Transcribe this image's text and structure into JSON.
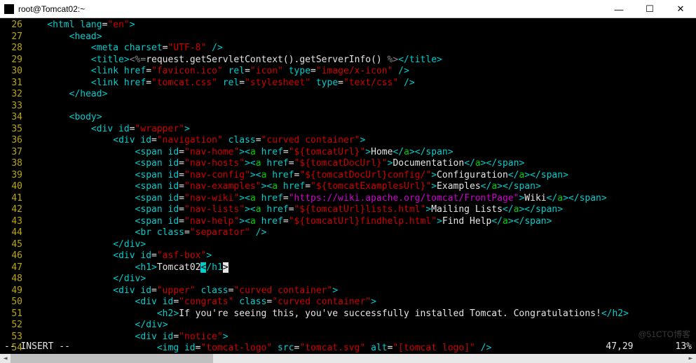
{
  "title": "root@Tomcat02:~",
  "lines": {
    "l26": {
      "n": "26",
      "i": 1,
      "seg": [
        [
          "<",
          "c-cyan"
        ],
        [
          "html",
          "c-cyan"
        ],
        [
          " lang",
          "c-cyan"
        ],
        [
          "=",
          "c-wht"
        ],
        [
          "\"en\"",
          "c-red"
        ],
        [
          ">",
          "c-cyan"
        ]
      ]
    },
    "l27": {
      "n": "27",
      "i": 2,
      "seg": [
        [
          "<",
          "c-cyan"
        ],
        [
          "head",
          "c-cyan"
        ],
        [
          ">",
          "c-cyan"
        ]
      ]
    },
    "l28": {
      "n": "28",
      "i": 3,
      "seg": [
        [
          "<",
          "c-cyan"
        ],
        [
          "meta",
          "c-cyan"
        ],
        [
          " charset",
          "c-cyan"
        ],
        [
          "=",
          "c-wht"
        ],
        [
          "\"UTF-8\"",
          "c-red"
        ],
        [
          " />",
          "c-cyan"
        ]
      ]
    },
    "l29": {
      "n": "29",
      "i": 3,
      "seg": [
        [
          "<",
          "c-cyan"
        ],
        [
          "title",
          "c-cyan"
        ],
        [
          ">",
          "c-cyan"
        ],
        [
          "<%=",
          "c-gry"
        ],
        [
          "request.getServletContext().getServerInfo()",
          "c-wht"
        ],
        [
          " %>",
          "c-gry"
        ],
        [
          "</",
          "c-cyan"
        ],
        [
          "title",
          "c-cyan"
        ],
        [
          ">",
          "c-cyan"
        ]
      ]
    },
    "l30": {
      "n": "30",
      "i": 3,
      "seg": [
        [
          "<",
          "c-cyan"
        ],
        [
          "link",
          "c-cyan"
        ],
        [
          " href",
          "c-cyan"
        ],
        [
          "=",
          "c-wht"
        ],
        [
          "\"favicon.ico\"",
          "c-red"
        ],
        [
          " rel",
          "c-cyan"
        ],
        [
          "=",
          "c-wht"
        ],
        [
          "\"icon\"",
          "c-red"
        ],
        [
          " type",
          "c-cyan"
        ],
        [
          "=",
          "c-wht"
        ],
        [
          "\"image/x-icon\"",
          "c-red"
        ],
        [
          " />",
          "c-cyan"
        ]
      ]
    },
    "l31": {
      "n": "31",
      "i": 3,
      "seg": [
        [
          "<",
          "c-cyan"
        ],
        [
          "link",
          "c-cyan"
        ],
        [
          " href",
          "c-cyan"
        ],
        [
          "=",
          "c-wht"
        ],
        [
          "\"tomcat.css\"",
          "c-red"
        ],
        [
          " rel",
          "c-cyan"
        ],
        [
          "=",
          "c-wht"
        ],
        [
          "\"stylesheet\"",
          "c-red"
        ],
        [
          " type",
          "c-cyan"
        ],
        [
          "=",
          "c-wht"
        ],
        [
          "\"text/css\"",
          "c-red"
        ],
        [
          " />",
          "c-cyan"
        ]
      ]
    },
    "l32": {
      "n": "32",
      "i": 2,
      "seg": [
        [
          "</",
          "c-cyan"
        ],
        [
          "head",
          "c-cyan"
        ],
        [
          ">",
          "c-cyan"
        ]
      ]
    },
    "l33": {
      "n": "33",
      "i": 0,
      "seg": [
        [
          "",
          ""
        ]
      ]
    },
    "l34": {
      "n": "34",
      "i": 2,
      "seg": [
        [
          "<",
          "c-cyan"
        ],
        [
          "body",
          "c-cyan"
        ],
        [
          ">",
          "c-cyan"
        ]
      ]
    },
    "l35": {
      "n": "35",
      "i": 3,
      "seg": [
        [
          "<",
          "c-cyan"
        ],
        [
          "div",
          "c-cyan"
        ],
        [
          " id",
          "c-cyan"
        ],
        [
          "=",
          "c-wht"
        ],
        [
          "\"wrapper\"",
          "c-red"
        ],
        [
          ">",
          "c-cyan"
        ]
      ]
    },
    "l36": {
      "n": "36",
      "i": 4,
      "seg": [
        [
          "<",
          "c-cyan"
        ],
        [
          "div",
          "c-cyan"
        ],
        [
          " id",
          "c-cyan"
        ],
        [
          "=",
          "c-wht"
        ],
        [
          "\"navigation\"",
          "c-red"
        ],
        [
          " class",
          "c-cyan"
        ],
        [
          "=",
          "c-wht"
        ],
        [
          "\"curved container\"",
          "c-red"
        ],
        [
          ">",
          "c-cyan"
        ]
      ]
    },
    "l37": {
      "n": "37",
      "i": 5,
      "seg": [
        [
          "<",
          "c-cyan"
        ],
        [
          "span",
          "c-cyan"
        ],
        [
          " id",
          "c-cyan"
        ],
        [
          "=",
          "c-wht"
        ],
        [
          "\"nav-home\"",
          "c-red"
        ],
        [
          "><",
          "c-cyan"
        ],
        [
          "a",
          "c-grn"
        ],
        [
          " href",
          "c-cyan"
        ],
        [
          "=",
          "c-wht"
        ],
        [
          "\"${tomcatUrl}\"",
          "c-red"
        ],
        [
          ">",
          "c-cyan"
        ],
        [
          "Home",
          "c-wht"
        ],
        [
          "</",
          "c-cyan"
        ],
        [
          "a",
          "c-grn"
        ],
        [
          "></",
          "c-cyan"
        ],
        [
          "span",
          "c-cyan"
        ],
        [
          ">",
          "c-cyan"
        ]
      ]
    },
    "l38": {
      "n": "38",
      "i": 5,
      "seg": [
        [
          "<",
          "c-cyan"
        ],
        [
          "span",
          "c-cyan"
        ],
        [
          " id",
          "c-cyan"
        ],
        [
          "=",
          "c-wht"
        ],
        [
          "\"nav-hosts\"",
          "c-red"
        ],
        [
          "><",
          "c-cyan"
        ],
        [
          "a",
          "c-grn"
        ],
        [
          " href",
          "c-cyan"
        ],
        [
          "=",
          "c-wht"
        ],
        [
          "\"${tomcatDocUrl}\"",
          "c-red"
        ],
        [
          ">",
          "c-cyan"
        ],
        [
          "Documentation",
          "c-wht"
        ],
        [
          "</",
          "c-cyan"
        ],
        [
          "a",
          "c-grn"
        ],
        [
          "></",
          "c-cyan"
        ],
        [
          "span",
          "c-cyan"
        ],
        [
          ">",
          "c-cyan"
        ]
      ]
    },
    "l39": {
      "n": "39",
      "i": 5,
      "seg": [
        [
          "<",
          "c-cyan"
        ],
        [
          "span",
          "c-cyan"
        ],
        [
          " id",
          "c-cyan"
        ],
        [
          "=",
          "c-wht"
        ],
        [
          "\"nav-config\"",
          "c-red"
        ],
        [
          "><",
          "c-cyan"
        ],
        [
          "a",
          "c-grn"
        ],
        [
          " href",
          "c-cyan"
        ],
        [
          "=",
          "c-wht"
        ],
        [
          "\"${tomcatDocUrl}config/\"",
          "c-red"
        ],
        [
          ">",
          "c-cyan"
        ],
        [
          "Configuration",
          "c-wht"
        ],
        [
          "</",
          "c-cyan"
        ],
        [
          "a",
          "c-grn"
        ],
        [
          "></",
          "c-cyan"
        ],
        [
          "span",
          "c-cyan"
        ],
        [
          ">",
          "c-cyan"
        ]
      ]
    },
    "l40": {
      "n": "40",
      "i": 5,
      "seg": [
        [
          "<",
          "c-cyan"
        ],
        [
          "span",
          "c-cyan"
        ],
        [
          " id",
          "c-cyan"
        ],
        [
          "=",
          "c-wht"
        ],
        [
          "\"nav-examples\"",
          "c-red"
        ],
        [
          "><",
          "c-cyan"
        ],
        [
          "a",
          "c-grn"
        ],
        [
          " href",
          "c-cyan"
        ],
        [
          "=",
          "c-wht"
        ],
        [
          "\"${tomcatExamplesUrl}\"",
          "c-red"
        ],
        [
          ">",
          "c-cyan"
        ],
        [
          "Examples",
          "c-wht"
        ],
        [
          "</",
          "c-cyan"
        ],
        [
          "a",
          "c-grn"
        ],
        [
          "></",
          "c-cyan"
        ],
        [
          "span",
          "c-cyan"
        ],
        [
          ">",
          "c-cyan"
        ]
      ]
    },
    "l41": {
      "n": "41",
      "i": 5,
      "seg": [
        [
          "<",
          "c-cyan"
        ],
        [
          "span",
          "c-cyan"
        ],
        [
          " id",
          "c-cyan"
        ],
        [
          "=",
          "c-wht"
        ],
        [
          "\"nav-wiki\"",
          "c-red"
        ],
        [
          "><",
          "c-cyan"
        ],
        [
          "a",
          "c-grn"
        ],
        [
          " href",
          "c-cyan"
        ],
        [
          "=",
          "c-wht"
        ],
        [
          "\"https://wiki.apache.org/tomcat/FrontPage\"",
          "c-mag"
        ],
        [
          ">",
          "c-cyan"
        ],
        [
          "Wiki",
          "c-wht"
        ],
        [
          "</",
          "c-cyan"
        ],
        [
          "a",
          "c-grn"
        ],
        [
          "></",
          "c-cyan"
        ],
        [
          "span",
          "c-cyan"
        ],
        [
          ">",
          "c-cyan"
        ]
      ]
    },
    "l42": {
      "n": "42",
      "i": 5,
      "seg": [
        [
          "<",
          "c-cyan"
        ],
        [
          "span",
          "c-cyan"
        ],
        [
          " id",
          "c-cyan"
        ],
        [
          "=",
          "c-wht"
        ],
        [
          "\"nav-lists\"",
          "c-red"
        ],
        [
          "><",
          "c-cyan"
        ],
        [
          "a",
          "c-grn"
        ],
        [
          " href",
          "c-cyan"
        ],
        [
          "=",
          "c-wht"
        ],
        [
          "\"${tomcatUrl}lists.html\"",
          "c-red"
        ],
        [
          ">",
          "c-cyan"
        ],
        [
          "Mailing Lists",
          "c-wht"
        ],
        [
          "</",
          "c-cyan"
        ],
        [
          "a",
          "c-grn"
        ],
        [
          "></",
          "c-cyan"
        ],
        [
          "span",
          "c-cyan"
        ],
        [
          ">",
          "c-cyan"
        ]
      ]
    },
    "l43": {
      "n": "43",
      "i": 5,
      "seg": [
        [
          "<",
          "c-cyan"
        ],
        [
          "span",
          "c-cyan"
        ],
        [
          " id",
          "c-cyan"
        ],
        [
          "=",
          "c-wht"
        ],
        [
          "\"nav-help\"",
          "c-red"
        ],
        [
          "><",
          "c-cyan"
        ],
        [
          "a",
          "c-grn"
        ],
        [
          " href",
          "c-cyan"
        ],
        [
          "=",
          "c-wht"
        ],
        [
          "\"${tomcatUrl}findhelp.html\"",
          "c-red"
        ],
        [
          ">",
          "c-cyan"
        ],
        [
          "Find Help",
          "c-wht"
        ],
        [
          "</",
          "c-cyan"
        ],
        [
          "a",
          "c-grn"
        ],
        [
          "></",
          "c-cyan"
        ],
        [
          "span",
          "c-cyan"
        ],
        [
          ">",
          "c-cyan"
        ]
      ]
    },
    "l44": {
      "n": "44",
      "i": 5,
      "seg": [
        [
          "<",
          "c-cyan"
        ],
        [
          "br",
          "c-cyan"
        ],
        [
          " class",
          "c-cyan"
        ],
        [
          "=",
          "c-wht"
        ],
        [
          "\"separator\"",
          "c-red"
        ],
        [
          " />",
          "c-cyan"
        ]
      ]
    },
    "l45": {
      "n": "45",
      "i": 4,
      "seg": [
        [
          "</",
          "c-cyan"
        ],
        [
          "div",
          "c-cyan"
        ],
        [
          ">",
          "c-cyan"
        ]
      ]
    },
    "l46": {
      "n": "46",
      "i": 4,
      "seg": [
        [
          "<",
          "c-cyan"
        ],
        [
          "div",
          "c-cyan"
        ],
        [
          " id",
          "c-cyan"
        ],
        [
          "=",
          "c-wht"
        ],
        [
          "\"asf-box\"",
          "c-red"
        ],
        [
          ">",
          "c-cyan"
        ]
      ]
    },
    "l47": {
      "n": "47",
      "i": 5,
      "seg": [
        [
          "<",
          "c-cyan"
        ],
        [
          "h1",
          "c-cyan"
        ],
        [
          ">",
          "c-cyan"
        ],
        [
          "Tomcat02",
          "c-wht"
        ],
        [
          "<",
          "cur-b"
        ],
        [
          "/h1",
          "c-cyan"
        ],
        [
          ">",
          "cur-w"
        ]
      ]
    },
    "l48": {
      "n": "48",
      "i": 4,
      "seg": [
        [
          "</",
          "c-cyan"
        ],
        [
          "div",
          "c-cyan"
        ],
        [
          ">",
          "c-cyan"
        ]
      ]
    },
    "l49": {
      "n": "49",
      "i": 4,
      "seg": [
        [
          "<",
          "c-cyan"
        ],
        [
          "div",
          "c-cyan"
        ],
        [
          " id",
          "c-cyan"
        ],
        [
          "=",
          "c-wht"
        ],
        [
          "\"upper\"",
          "c-red"
        ],
        [
          " class",
          "c-cyan"
        ],
        [
          "=",
          "c-wht"
        ],
        [
          "\"curved container\"",
          "c-red"
        ],
        [
          ">",
          "c-cyan"
        ]
      ]
    },
    "l50": {
      "n": "50",
      "i": 5,
      "seg": [
        [
          "<",
          "c-cyan"
        ],
        [
          "div",
          "c-cyan"
        ],
        [
          " id",
          "c-cyan"
        ],
        [
          "=",
          "c-wht"
        ],
        [
          "\"congrats\"",
          "c-red"
        ],
        [
          " class",
          "c-cyan"
        ],
        [
          "=",
          "c-wht"
        ],
        [
          "\"curved container\"",
          "c-red"
        ],
        [
          ">",
          "c-cyan"
        ]
      ]
    },
    "l51": {
      "n": "51",
      "i": 6,
      "seg": [
        [
          "<",
          "c-cyan"
        ],
        [
          "h2",
          "c-cyan"
        ],
        [
          ">",
          "c-cyan"
        ],
        [
          "If you're seeing this, you've successfully installed Tomcat. Congratulations!",
          "c-wht"
        ],
        [
          "</",
          "c-cyan"
        ],
        [
          "h2",
          "c-cyan"
        ],
        [
          ">",
          "c-cyan"
        ]
      ]
    },
    "l52": {
      "n": "52",
      "i": 5,
      "seg": [
        [
          "</",
          "c-cyan"
        ],
        [
          "div",
          "c-cyan"
        ],
        [
          ">",
          "c-cyan"
        ]
      ]
    },
    "l53": {
      "n": "53",
      "i": 5,
      "seg": [
        [
          "<",
          "c-cyan"
        ],
        [
          "div",
          "c-cyan"
        ],
        [
          " id",
          "c-cyan"
        ],
        [
          "=",
          "c-wht"
        ],
        [
          "\"notice\"",
          "c-red"
        ],
        [
          ">",
          "c-cyan"
        ]
      ]
    },
    "l54": {
      "n": "54",
      "i": 6,
      "seg": [
        [
          "<",
          "c-cyan"
        ],
        [
          "img",
          "c-cyan"
        ],
        [
          " id",
          "c-cyan"
        ],
        [
          "=",
          "c-wht"
        ],
        [
          "\"tomcat-logo\"",
          "c-red"
        ],
        [
          " src",
          "c-cyan"
        ],
        [
          "=",
          "c-wht"
        ],
        [
          "\"tomcat.svg\"",
          "c-red"
        ],
        [
          " alt",
          "c-cyan"
        ],
        [
          "=",
          "c-wht"
        ],
        [
          "\"[tomcat logo]\"",
          "c-red"
        ],
        [
          " />",
          "c-cyan"
        ]
      ]
    }
  },
  "order": [
    "l26",
    "l27",
    "l28",
    "l29",
    "l30",
    "l31",
    "l32",
    "l33",
    "l34",
    "l35",
    "l36",
    "l37",
    "l38",
    "l39",
    "l40",
    "l41",
    "l42",
    "l43",
    "l44",
    "l45",
    "l46",
    "l47",
    "l48",
    "l49",
    "l50",
    "l51",
    "l52",
    "l53",
    "l54"
  ],
  "status": {
    "mode": "-- INSERT --",
    "pos": "47,29",
    "pct": "13%"
  },
  "watermark": "@51CTO博客",
  "win": {
    "min": "—",
    "max": "☐",
    "close": "✕"
  }
}
